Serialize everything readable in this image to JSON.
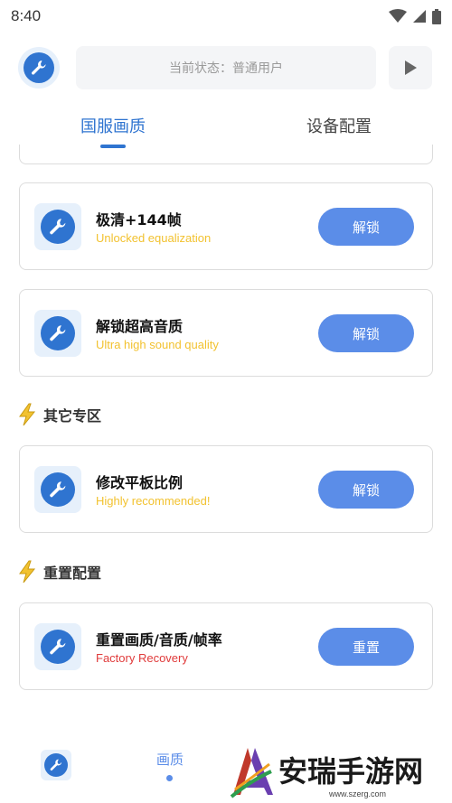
{
  "status_bar": {
    "time": "8:40"
  },
  "header": {
    "status_text": "当前状态：普通用户"
  },
  "tabs": [
    {
      "label": "国服画质",
      "active": true
    },
    {
      "label": "设备配置",
      "active": false
    }
  ],
  "cards": [
    {
      "title": "极清+144帧",
      "subtitle": "Unlocked equalization",
      "button": "解锁"
    },
    {
      "title": "解锁超高音质",
      "subtitle": "Ultra high sound quality",
      "button": "解锁"
    },
    {
      "title": "修改平板比例",
      "subtitle": "Highly recommended!",
      "button": "解锁"
    },
    {
      "title": "重置画质/音质/帧率",
      "subtitle": "Factory Recovery",
      "button": "重置"
    }
  ],
  "sections": [
    {
      "title": "其它专区"
    },
    {
      "title": "重置配置"
    }
  ],
  "bottom_nav": {
    "label": "画质"
  },
  "watermark": {
    "text": "安瑞手游网",
    "url": "www.szerg.com"
  },
  "colors": {
    "accent": "#2f74d0",
    "button": "#5b8de8",
    "subtitle_yellow": "#f2c230",
    "subtitle_red": "#e03b3b"
  }
}
